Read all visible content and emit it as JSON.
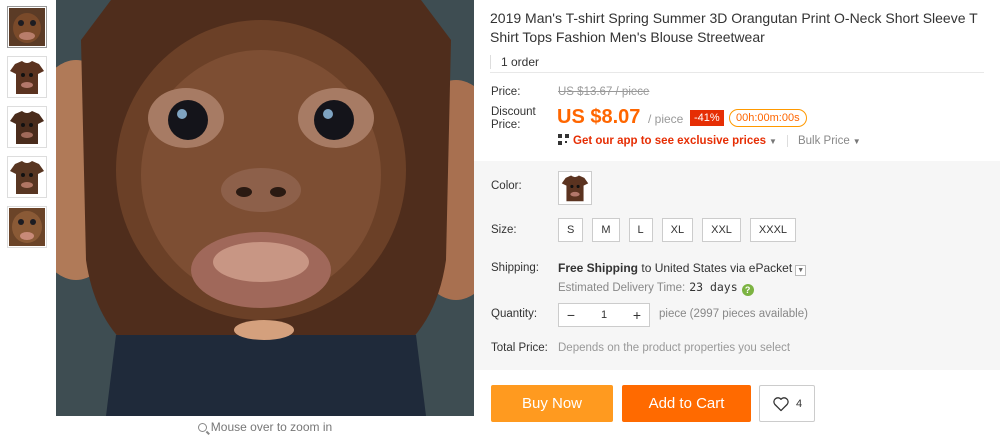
{
  "gallery": {
    "thumbnail_count": 5,
    "zoom_hint": "Mouse over to zoom in"
  },
  "product": {
    "title": "2019 Man's T-shirt Spring Summer 3D Orangutan Print O-Neck Short Sleeve T Shirt Tops Fashion Men's Blouse Streetwear",
    "orders": "1 order"
  },
  "price": {
    "label": "Price:",
    "original": "US $13.67 / piece",
    "discount_label_1": "Discount",
    "discount_label_2": "Price:",
    "current": "US $8.07",
    "unit": "/ piece",
    "discount_percent": "-41%",
    "countdown": "00h:00m:00s",
    "app_promo": "Get our app to see exclusive prices",
    "bulk_price": "Bulk Price"
  },
  "options": {
    "color_label": "Color:",
    "size_label": "Size:",
    "sizes": [
      "S",
      "M",
      "L",
      "XL",
      "XXL",
      "XXXL"
    ]
  },
  "shipping": {
    "label": "Shipping:",
    "free": "Free Shipping",
    "to": "to",
    "country": "United States",
    "via": "via",
    "method": "ePacket",
    "estimate_label": "Estimated Delivery Time:",
    "estimate_value": "23 days"
  },
  "quantity": {
    "label": "Quantity:",
    "value": "1",
    "minus": "−",
    "plus": "+",
    "available": "piece (2997 pieces available)"
  },
  "total": {
    "label": "Total Price:",
    "value": "Depends on the product properties you select"
  },
  "actions": {
    "buy_now": "Buy Now",
    "add_to_cart": "Add to Cart",
    "wishlist_count": "4"
  },
  "colors": {
    "accent": "#ff6a00",
    "buy_now": "#ff9a1f",
    "price_red": "#e62e04"
  }
}
